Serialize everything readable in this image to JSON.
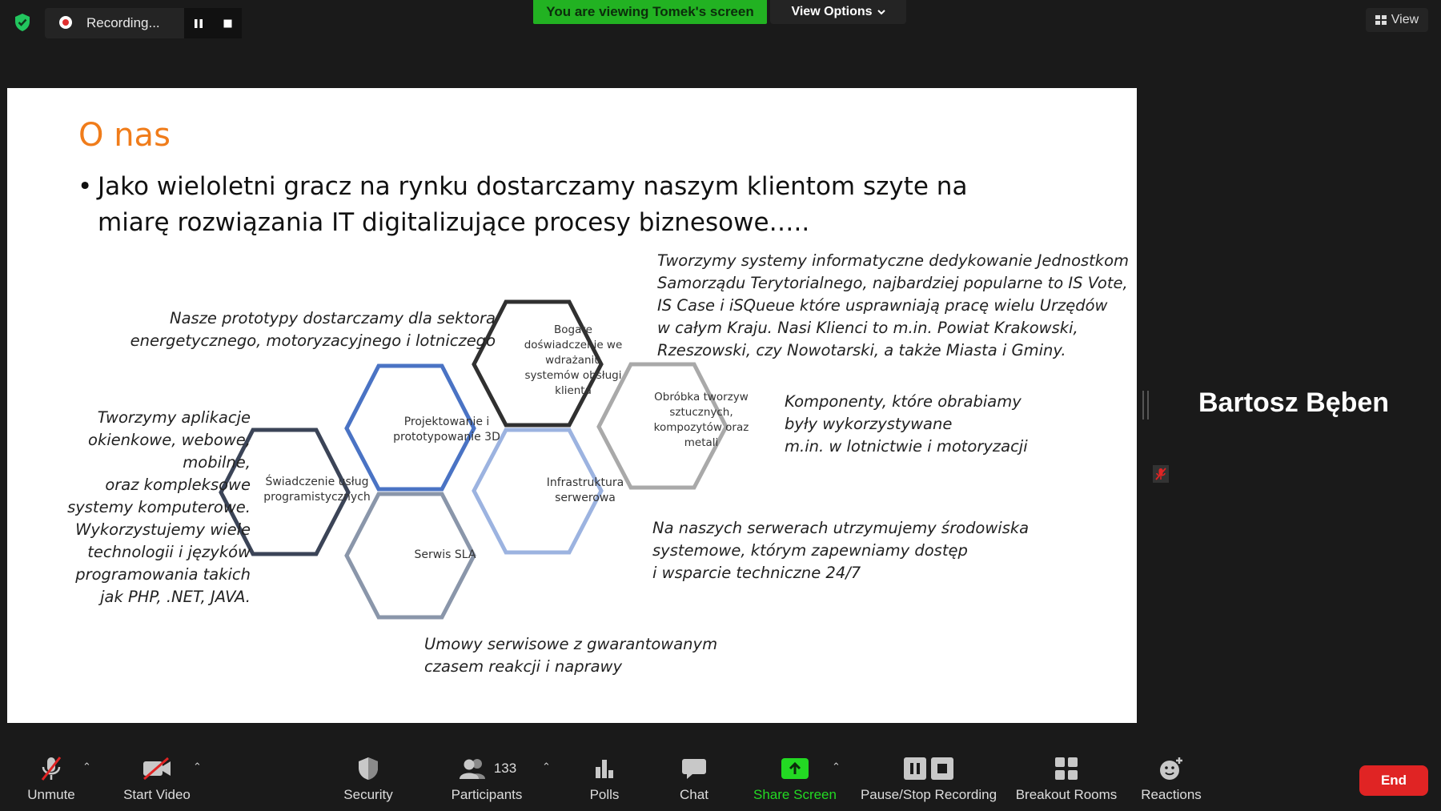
{
  "top_bar": {
    "recording_label": "Recording...",
    "banner_text": "You are viewing Tomek's screen",
    "view_options_label": "View Options",
    "view_label": "View"
  },
  "slide": {
    "title": "O nas",
    "bullet_lines": [
      "Jako wieloletni gracz na rynku dostarczamy naszym klientom szyte na",
      "miarę rozwiązania IT digitalizujące procesy biznesowe….."
    ],
    "notes": {
      "prototypes": [
        "Nasze prototypy dostarczamy dla sektora",
        "energetycznego, motoryzacyjnego i lotniczego"
      ],
      "applications": [
        "Tworzymy aplikacje",
        "okienkowe, webowe,",
        "mobilne,",
        "oraz kompleksowe",
        "systemy komputerowe.",
        "Wykorzystujemy wiele",
        "technologii i języków",
        "programowania takich",
        "jak PHP, .NET, JAVA."
      ],
      "systems": [
        "Tworzymy systemy informatyczne dedykowanie Jednostkom",
        "Samorządu Terytorialnego, najbardziej popularne to IS Vote,",
        "IS Case i iSQueue które usprawniają pracę wielu Urzędów",
        "w całym Kraju. Nasi Klienci to m.in. Powiat Krakowski,",
        "Rzeszowski, czy Nowotarski, a także Miasta i Gminy."
      ],
      "components": [
        "Komponenty, które obrabiamy",
        "były wykorzystywane",
        "m.in. w lotnictwie i motoryzacji"
      ],
      "servers": [
        "Na naszych serwerach utrzymujemy środowiska",
        "systemowe, którym zapewniamy dostęp",
        "i wsparcie techniczne 24/7"
      ],
      "contracts": [
        "Umowy serwisowe z gwarantowanym",
        "czasem reakcji i naprawy"
      ]
    },
    "hexagons": {
      "programming": "Świadczenie usług programistycznych",
      "design": "Projektowanie i prototypowanie 3D",
      "experience": "Bogate doświadczenie we wdrażaniu systemów obsługi klienta",
      "processing": "Obróbka tworzyw sztucznych, kompozytów oraz metali",
      "infrastructure": "Infrastruktura serwerowa",
      "sla": "Serwis SLA"
    },
    "hex_colors": {
      "programming": "#3b4457",
      "design": "#4a73c4",
      "experience": "#303030",
      "processing": "#a9a9a9",
      "infrastructure": "#9cb3e0",
      "sla": "#8a96aa"
    }
  },
  "side_panel": {
    "participant_name": "Bartosz Bęben"
  },
  "toolbar": {
    "unmute": "Unmute",
    "start_video": "Start Video",
    "security": "Security",
    "participants": "Participants",
    "participants_count": "133",
    "polls": "Polls",
    "chat": "Chat",
    "share_screen": "Share Screen",
    "pause_stop_recording": "Pause/Stop Recording",
    "breakout_rooms": "Breakout Rooms",
    "reactions": "Reactions",
    "end": "End"
  },
  "colors": {
    "accent_green": "#23d923",
    "end_red": "#e02424",
    "title_orange": "#f07c1a"
  }
}
